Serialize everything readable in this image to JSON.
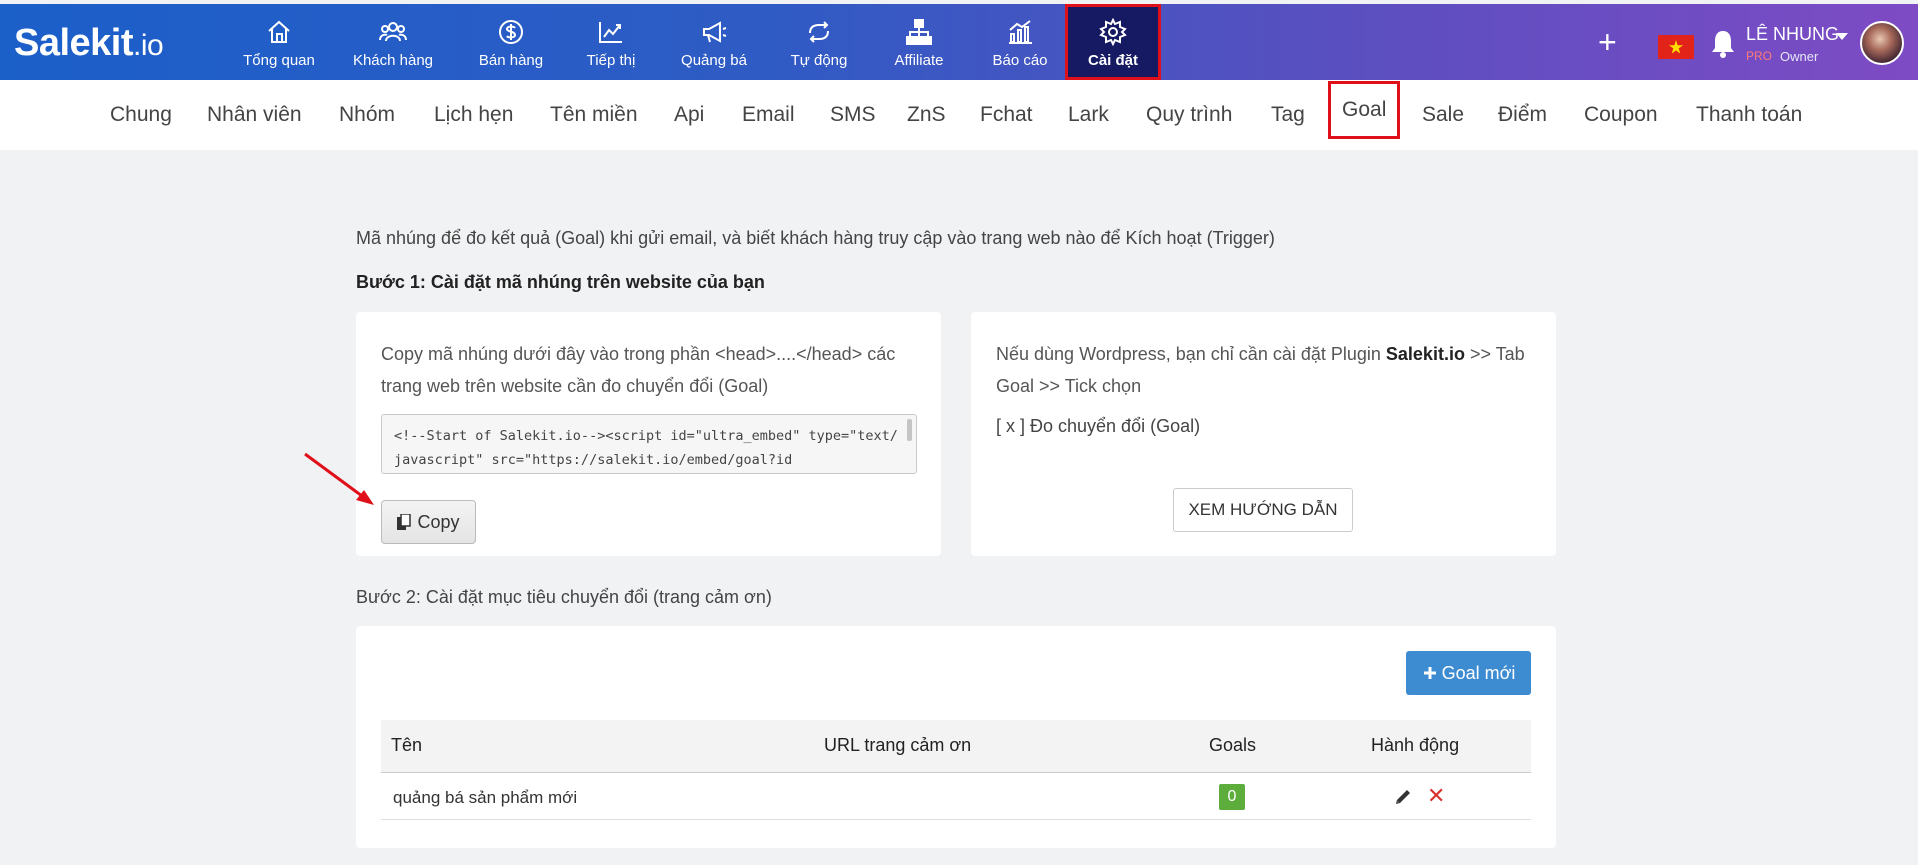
{
  "brand": {
    "name": "Salekit",
    "suffix": ".io"
  },
  "nav": [
    {
      "label": "Tổng quan",
      "icon": "home-icon"
    },
    {
      "label": "Khách hàng",
      "icon": "users-icon"
    },
    {
      "label": "Bán hàng",
      "icon": "dollar-icon"
    },
    {
      "label": "Tiếp thị",
      "icon": "trend-icon"
    },
    {
      "label": "Quảng bá",
      "icon": "megaphone-icon"
    },
    {
      "label": "Tự động",
      "icon": "repeat-icon"
    },
    {
      "label": "Affiliate",
      "icon": "network-icon"
    },
    {
      "label": "Báo cáo",
      "icon": "report-icon"
    },
    {
      "label": "Cài đặt",
      "icon": "gear-icon",
      "active": true
    }
  ],
  "topbar": {
    "plus": "+",
    "user_name": "LÊ NHUNG",
    "user_plan": "PRO",
    "user_role": "Owner"
  },
  "subtabs": [
    "Chung",
    "Nhân viên",
    "Nhóm",
    "Lịch hẹn",
    "Tên miền",
    "Api",
    "Email",
    "SMS",
    "ZnS",
    "Fchat",
    "Lark",
    "Quy trình",
    "Tag",
    "Goal",
    "Sale",
    "Điểm",
    "Coupon",
    "Thanh toán"
  ],
  "active_subtab": "Goal",
  "content": {
    "intro": "Mã nhúng để đo kết quả (Goal) khi gửi email, và biết khách hàng truy cập vào trang web nào để Kích hoạt (Trigger)",
    "step1": "Bước 1: Cài đặt mã nhúng trên website của bạn",
    "card1_text": "Copy mã nhúng dưới đây vào trong phần <head>....</head> các trang web trên website cần đo chuyển đổi (Goal)",
    "embed_code": "<!--Start of Salekit.io--><script id=\"ultra_embed\" type=\"text/javascript\" src=\"https://salekit.io/embed/goal?id",
    "copy_label": "Copy",
    "card2_text_a": "Nếu dùng Wordpress, bạn chỉ cần cài đặt Plugin ",
    "card2_text_b": "Salekit.io",
    "card2_text_c": " >> Tab Goal >> Tick chọn",
    "card2_check": "[ x ] Đo chuyển đổi (Goal)",
    "guide_label": "XEM HƯỚNG DẪN",
    "step2": "Bước 2: Cài đặt mục tiêu chuyển đổi (trang cảm ơn)",
    "new_goal_label": "Goal mới"
  },
  "table": {
    "headers": [
      "Tên",
      "URL trang cảm ơn",
      "Goals",
      "Hành động"
    ],
    "rows": [
      {
        "name": "quảng bá sản phẩm mới",
        "url": "",
        "goals": "0"
      }
    ]
  },
  "colors": {
    "accent": "#3d8bd1",
    "highlight": "#e0101b",
    "badge": "#5cad3c",
    "delete": "#d9322e"
  }
}
